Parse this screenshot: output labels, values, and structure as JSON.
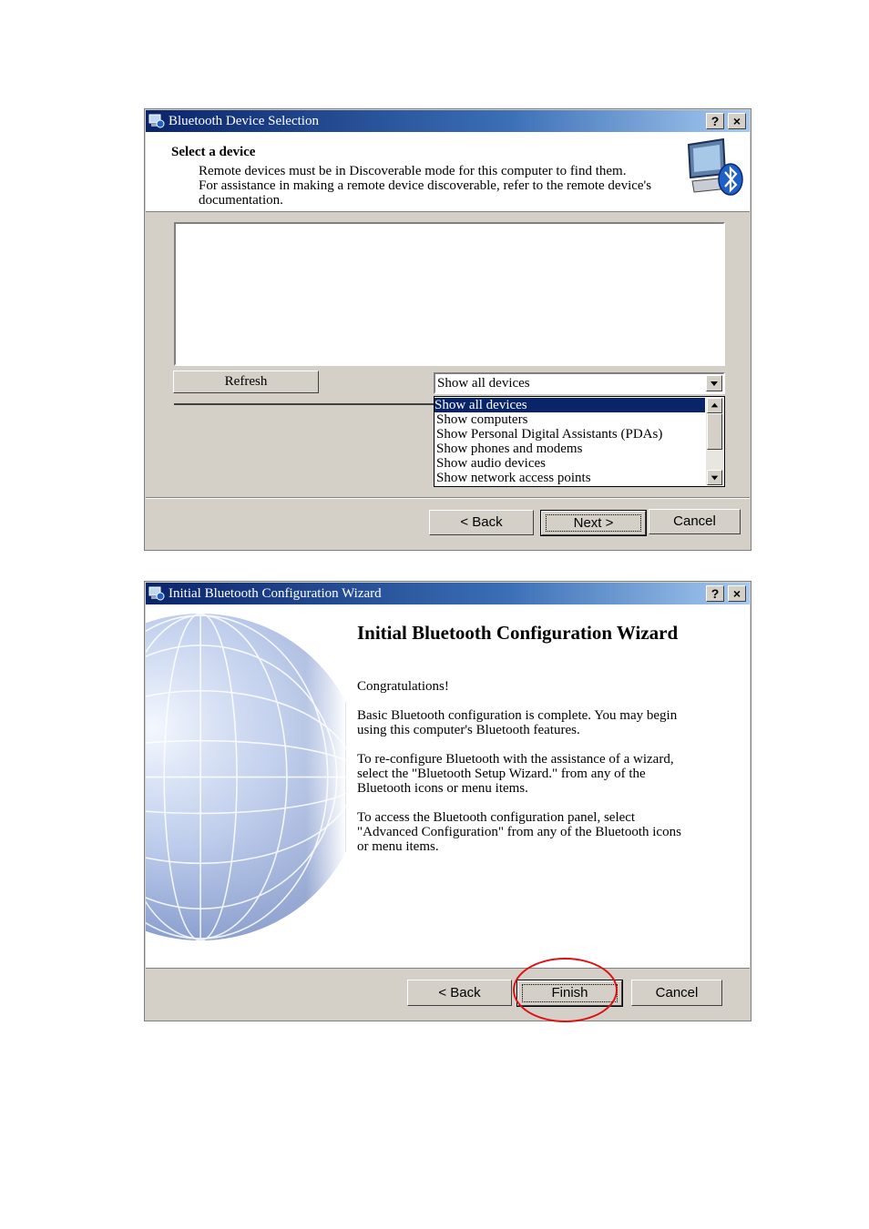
{
  "dialog1": {
    "title": "Bluetooth Device Selection",
    "help_button": "?",
    "close_button": "×",
    "heading": "Select a device",
    "desc_line1": "Remote devices must be in Discoverable mode for this computer to find them.",
    "desc_line2": "For assistance in making a remote device discoverable, refer to the remote device's",
    "desc_line3": "documentation.",
    "refresh_button": "Refresh",
    "filter_selected": "Show all devices",
    "filter_options": [
      "Show all devices",
      "Show computers",
      "Show Personal Digital Assistants (PDAs)",
      "Show phones and modems",
      "Show audio devices",
      "Show network access points"
    ],
    "back_button": "< Back",
    "next_button": "Next >",
    "cancel_button": "Cancel"
  },
  "dialog2": {
    "title": "Initial Bluetooth Configuration Wizard",
    "help_button": "?",
    "close_button": "×",
    "heading": "Initial Bluetooth Configuration Wizard",
    "congrats": "Congratulations!",
    "para1": "Basic Bluetooth configuration is complete.  You may begin\nusing this computer's Bluetooth features.",
    "para2": "To re-configure Bluetooth with the assistance of a wizard,\nselect the \"Bluetooth Setup Wizard.\" from any of the\nBluetooth icons or menu items.",
    "para3": "To access the Bluetooth configuration panel, select\n\"Advanced Configuration\" from any of the Bluetooth icons\nor menu items.",
    "back_button": "< Back",
    "finish_button": "Finish",
    "cancel_button": "Cancel",
    "highlight_color": "#e01010"
  }
}
